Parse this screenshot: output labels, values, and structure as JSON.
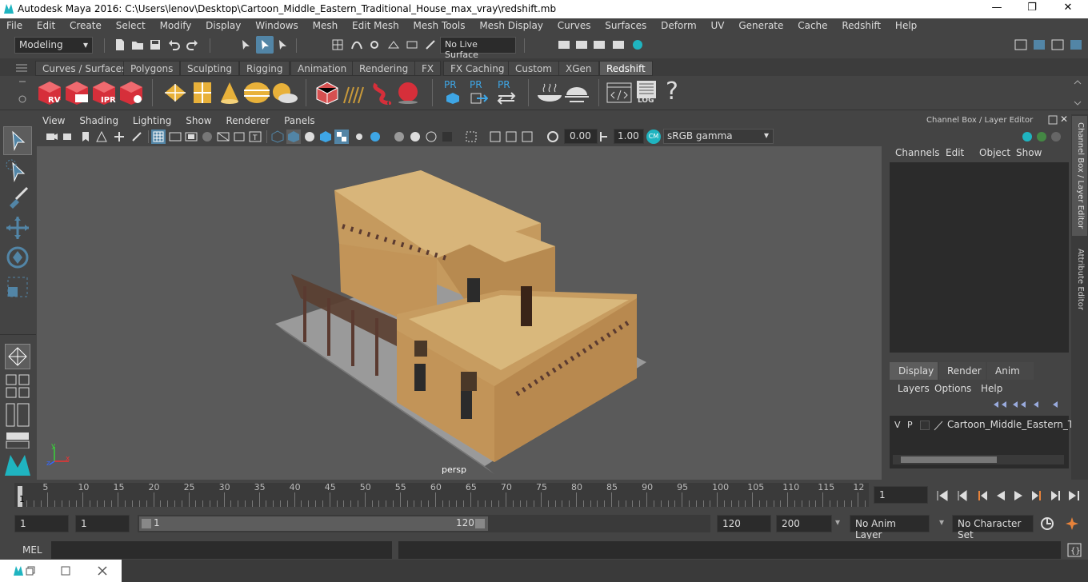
{
  "window": {
    "title": "Autodesk Maya 2016: C:\\Users\\lenov\\Desktop\\Cartoon_Middle_Eastern_Traditional_House_max_vray\\redshift.mb",
    "minimize": "—",
    "maximize": "❐",
    "close": "✕"
  },
  "menu": [
    "File",
    "Edit",
    "Create",
    "Select",
    "Modify",
    "Display",
    "Windows",
    "Mesh",
    "Edit Mesh",
    "Mesh Tools",
    "Mesh Display",
    "Curves",
    "Surfaces",
    "Deform",
    "UV",
    "Generate",
    "Cache",
    "Redshift",
    "Help"
  ],
  "status": {
    "mode": "Modeling",
    "live_surface": "No Live Surface"
  },
  "shelf_tabs": [
    "Curves / Surfaces",
    "Polygons",
    "Sculpting",
    "Rigging",
    "Animation",
    "Rendering",
    "FX",
    "FX Caching",
    "Custom",
    "XGen",
    "Redshift"
  ],
  "shelf_active": "Redshift",
  "shelf_icon_labels": {
    "rv": "RV",
    "ipr": "IPR",
    "pr1": "PR",
    "pr2": "PR",
    "pr3": "PR",
    "log": "LOG",
    "help": "?"
  },
  "viewport_menu": [
    "View",
    "Shading",
    "Lighting",
    "Show",
    "Renderer",
    "Panels"
  ],
  "viewport_toolbar": {
    "exposure": "0.00",
    "gamma": "1.00",
    "color_space": "sRGB gamma",
    "cm_badge": "CM"
  },
  "viewport_label": "persp",
  "axis": {
    "x": "x",
    "y": "y",
    "z": "z"
  },
  "channel_box": {
    "title": "Channel Box / Layer Editor",
    "menu": [
      "Channels",
      "Edit",
      "Object",
      "Show"
    ]
  },
  "layer_editor": {
    "tabs": [
      "Display",
      "Render",
      "Anim"
    ],
    "active_tab": "Display",
    "menu": [
      "Layers",
      "Options",
      "Help"
    ],
    "layer": {
      "v": "V",
      "p": "P",
      "name": "Cartoon_Middle_Eastern_Tra"
    }
  },
  "side_tabs": [
    "Channel Box / Layer Editor",
    "Attribute Editor"
  ],
  "timeline": {
    "ticks": [
      "5",
      "10",
      "15",
      "20",
      "25",
      "30",
      "35",
      "40",
      "45",
      "50",
      "55",
      "60",
      "65",
      "70",
      "75",
      "80",
      "85",
      "90",
      "95",
      "100",
      "105",
      "110",
      "115",
      "12"
    ],
    "current_frame_marker": "1",
    "current_frame": "1"
  },
  "range": {
    "start": "1",
    "start2": "1",
    "slider_start": "1",
    "slider_end": "120",
    "end": "120",
    "end2": "200",
    "anim_layer": "No Anim Layer",
    "char_set": "No Character Set"
  },
  "mel": {
    "label": "MEL"
  },
  "colors": {
    "accent": "#5285a6",
    "maya_teal": "#1fb4c0",
    "redshift_red": "#d62f3a",
    "gold": "#e8b13a",
    "wall": "#c9a367"
  }
}
